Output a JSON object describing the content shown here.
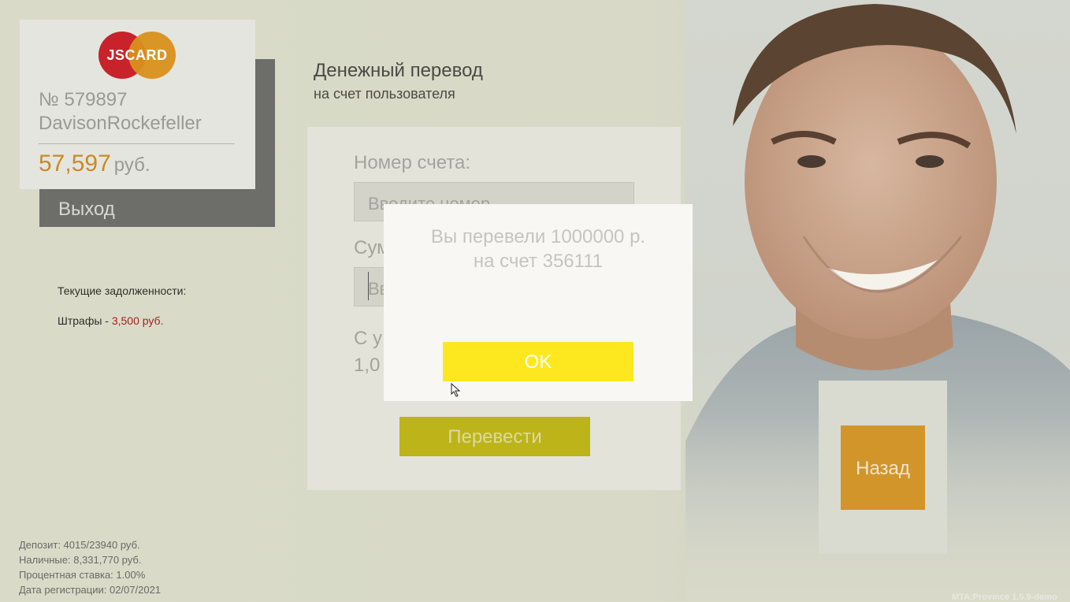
{
  "card": {
    "logo_text": "JSCARD",
    "number": "№ 579897",
    "holder": "DavisonRockefeller",
    "balance": "57,597",
    "currency": "руб."
  },
  "sidebar": {
    "exit_label": "Выход",
    "debts_title": "Текущие задолженности:",
    "fines_label": "Штрафы - ",
    "fines_amount": "3,500 руб."
  },
  "footer": {
    "deposit": "Депозит: 4015/23940 руб.",
    "cash": "Наличные: 8,331,770 руб.",
    "rate": "Процентная ставка: 1.00%",
    "registered": "Дата регистрации: 02/07/2021"
  },
  "transfer": {
    "title": "Денежный перевод",
    "subtitle": "на счет пользователя",
    "account_label": "Номер счета:",
    "account_placeholder": "Вводите номер",
    "sum_label": "Сумма:",
    "sum_placeholder": "Вв",
    "commission_label": "С у",
    "commission_value": "1,0",
    "submit_label": "Перевести"
  },
  "back_label": "Назад",
  "modal": {
    "line1": "Вы перевели 1000000 р.",
    "line2": "на счет 356111",
    "ok_label": "OK"
  },
  "version": "MTA:Province 1.5.9-demo",
  "colors": {
    "accent_yellow": "#fde81f",
    "accent_orange": "#d2952a",
    "fine_red": "#a8201c"
  }
}
